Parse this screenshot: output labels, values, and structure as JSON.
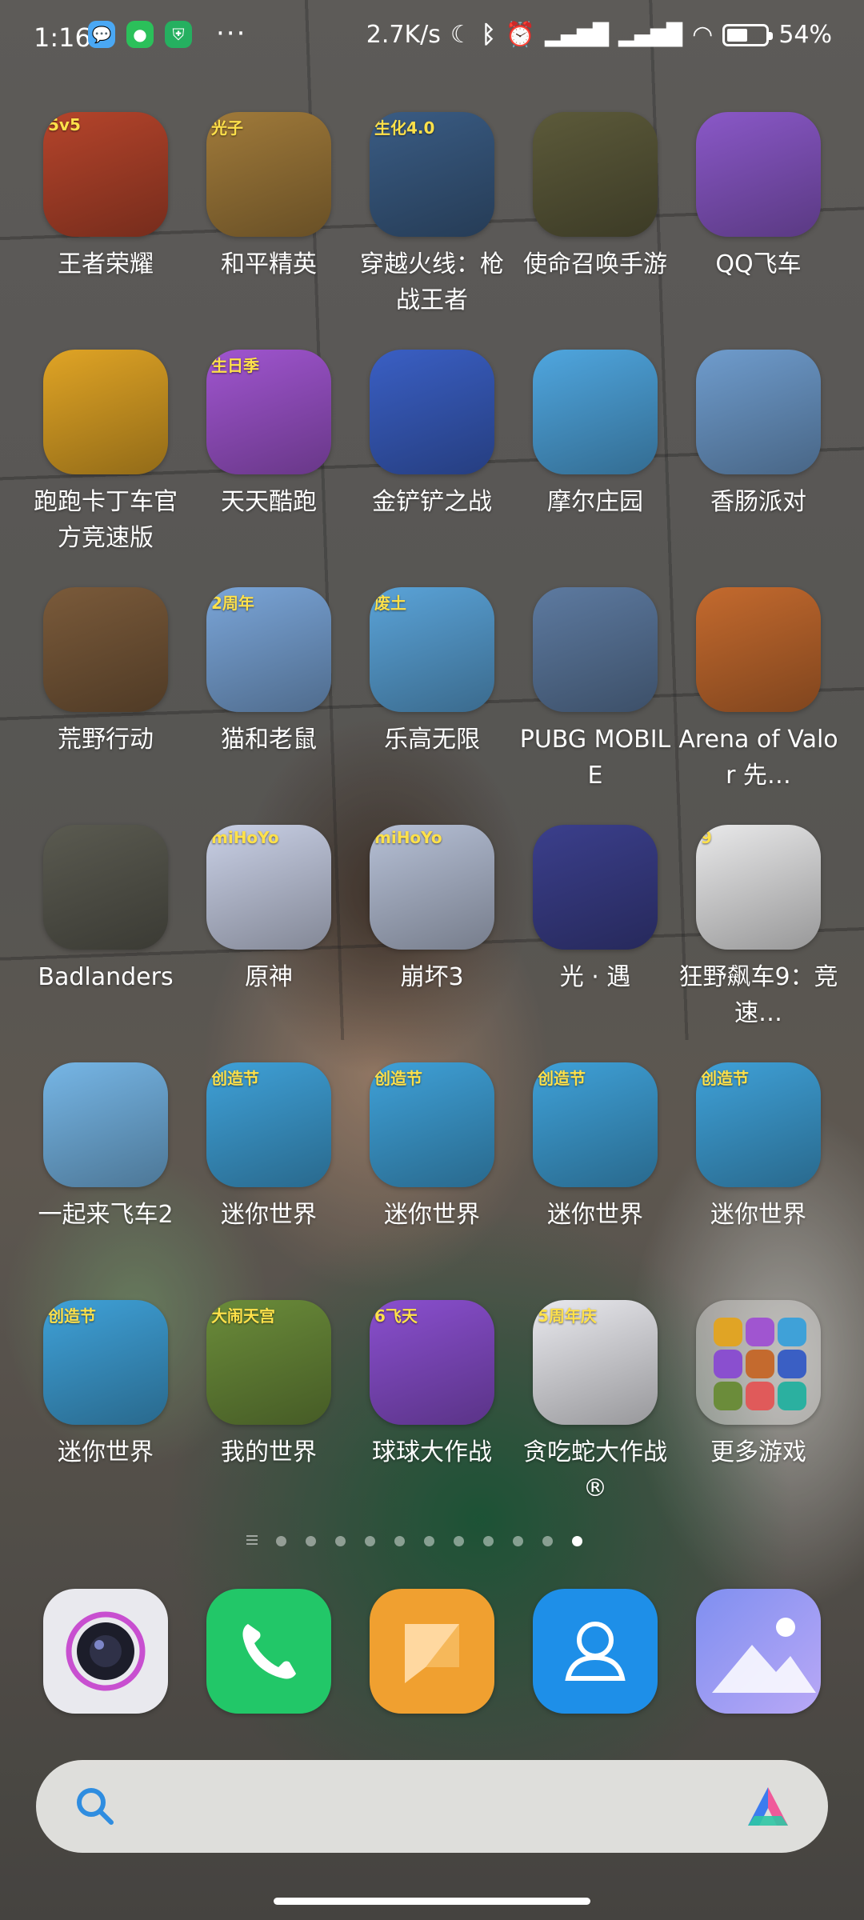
{
  "status_bar": {
    "time": "1:16",
    "more": "···",
    "net_speed": "2.7K/s",
    "battery_percent": "54%",
    "battery_level": 0.54,
    "icons": [
      "chat-bubble-icon",
      "wechat-icon",
      "shield-icon",
      "moon-icon",
      "bluetooth-icon",
      "alarm-icon",
      "signal-hd-icon",
      "signal-hd-icon",
      "wifi-icon",
      "battery-icon"
    ]
  },
  "apps": [
    {
      "label": "王者荣耀",
      "icon": "honor-of-kings",
      "badge": "5v5",
      "color": "#b5442b"
    },
    {
      "label": "和平精英",
      "icon": "game-for-peace",
      "badge": "光子",
      "color": "#a07a3a"
    },
    {
      "label": "穿越火线：枪战王者",
      "icon": "crossfire",
      "badge": "生化4.0",
      "color": "#3a5c84"
    },
    {
      "label": "使命召唤手游",
      "icon": "call-of-duty",
      "badge": "",
      "color": "#5c5a3a"
    },
    {
      "label": "QQ飞车",
      "icon": "qq-speed",
      "badge": "",
      "color": "#8a58c8"
    },
    {
      "label": "跑跑卡丁车官方竞速版",
      "icon": "kartrider",
      "badge": "",
      "color": "#e0a425"
    },
    {
      "label": "天天酷跑",
      "icon": "daily-parkour",
      "badge": "生日季",
      "color": "#a055d0"
    },
    {
      "label": "金铲铲之战",
      "icon": "golden-spatula",
      "badge": "",
      "color": "#3a5fc4"
    },
    {
      "label": "摩尔庄园",
      "icon": "mole-manor",
      "badge": "",
      "color": "#4fa6df"
    },
    {
      "label": "香肠派对",
      "icon": "sausage-party",
      "badge": "",
      "color": "#6f9ccd"
    },
    {
      "label": "荒野行动",
      "icon": "knives-out",
      "badge": "",
      "color": "#7a5a3a"
    },
    {
      "label": "猫和老鼠",
      "icon": "tom-and-jerry",
      "badge": "2周年",
      "color": "#7aa5d8"
    },
    {
      "label": "乐高无限",
      "icon": "lego-infinity",
      "badge": "废土",
      "color": "#5aa3d8"
    },
    {
      "label": "PUBG MOBILE",
      "icon": "pubg-mobile",
      "badge": "",
      "color": "#5d7aa0"
    },
    {
      "label": "Arena of Valor 先…",
      "icon": "arena-of-valor",
      "badge": "",
      "color": "#c46a2e"
    },
    {
      "label": "Badlanders",
      "icon": "badlanders",
      "badge": "",
      "color": "#5a5a50"
    },
    {
      "label": "原神",
      "icon": "genshin-impact",
      "badge": "miHoYo",
      "color": "#c9d0e6"
    },
    {
      "label": "崩坏3",
      "icon": "honkai-impact-3",
      "badge": "miHoYo",
      "color": "#b6c0d6"
    },
    {
      "label": "光 · 遇",
      "icon": "sky-children-of-light",
      "badge": "",
      "color": "#3b3f8c"
    },
    {
      "label": "狂野飙车9：竞速…",
      "icon": "asphalt-9",
      "badge": "9",
      "color": "#e9e9ea"
    },
    {
      "label": "一起来飞车2",
      "icon": "speed-drifters-2",
      "badge": "",
      "color": "#76b6e6"
    },
    {
      "label": "迷你世界",
      "icon": "mini-world",
      "badge": "创造节",
      "color": "#3fa1d8"
    },
    {
      "label": "迷你世界",
      "icon": "mini-world",
      "badge": "创造节",
      "color": "#3fa1d8"
    },
    {
      "label": "迷你世界",
      "icon": "mini-world",
      "badge": "创造节",
      "color": "#3fa1d8"
    },
    {
      "label": "迷你世界",
      "icon": "mini-world",
      "badge": "创造节",
      "color": "#3fa1d8"
    },
    {
      "label": "迷你世界",
      "icon": "mini-world",
      "badge": "创造节",
      "color": "#3fa1d8"
    },
    {
      "label": "我的世界",
      "icon": "minecraft",
      "badge": "大闹天宫",
      "color": "#6b8c3a"
    },
    {
      "label": "球球大作战",
      "icon": "battle-of-balls",
      "badge": "6飞天",
      "color": "#8a4fcf"
    },
    {
      "label": "贪吃蛇大作战®",
      "icon": "snake-vs",
      "badge": "5周年庆",
      "color": "#e9e9ee"
    },
    {
      "label": "更多游戏",
      "icon": "folder-games",
      "badge": "",
      "color": ""
    }
  ],
  "pager": {
    "pages": 12,
    "active": 12
  },
  "dock": [
    {
      "name": "camera",
      "color": "#e6e6ea"
    },
    {
      "name": "phone",
      "color": "#22c768"
    },
    {
      "name": "messages",
      "color": "#f0a030"
    },
    {
      "name": "contacts",
      "color": "#1e8fe8"
    },
    {
      "name": "gallery",
      "color": "#8f9ff0"
    }
  ],
  "search": {
    "icon": "search-icon",
    "assistant_icon": "assistant-icon"
  }
}
